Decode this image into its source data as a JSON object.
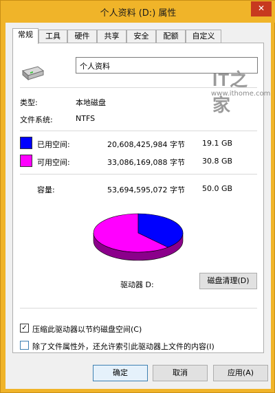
{
  "window": {
    "title": "个人资料 (D:) 属性",
    "close_glyph": "✕"
  },
  "tabs": [
    {
      "label": "常规",
      "active": true
    },
    {
      "label": "工具"
    },
    {
      "label": "硬件"
    },
    {
      "label": "共享"
    },
    {
      "label": "安全"
    },
    {
      "label": "配额"
    },
    {
      "label": "自定义"
    }
  ],
  "watermark": {
    "logo": "IT之家",
    "url": "www.ithome.com"
  },
  "general": {
    "drive_name": "个人资料",
    "type_label": "类型:",
    "type_value": "本地磁盘",
    "fs_label": "文件系统:",
    "fs_value": "NTFS",
    "used": {
      "label": "已用空间:",
      "bytes": "20,608,425,984 字节",
      "size": "19.1 GB",
      "color": "#0000ff"
    },
    "free": {
      "label": "可用空间:",
      "bytes": "33,086,169,088 字节",
      "size": "30.8 GB",
      "color": "#ff00ff"
    },
    "capacity": {
      "label": "容量:",
      "bytes": "53,694,595,072 字节",
      "size": "50.0 GB"
    },
    "drive_label": "驱动器 D:",
    "cleanup_button": "磁盘清理(D)",
    "compress_label": "压缩此驱动器以节约磁盘空间(C)",
    "compress_checked": true,
    "index_label": "除了文件属性外，还允许索引此驱动器上文件的内容(I)",
    "index_checked": false
  },
  "buttons": {
    "ok": "确定",
    "cancel": "取消",
    "apply": "应用(A)"
  },
  "pie": {
    "used_fraction": 0.384,
    "free_fraction": 0.616
  }
}
